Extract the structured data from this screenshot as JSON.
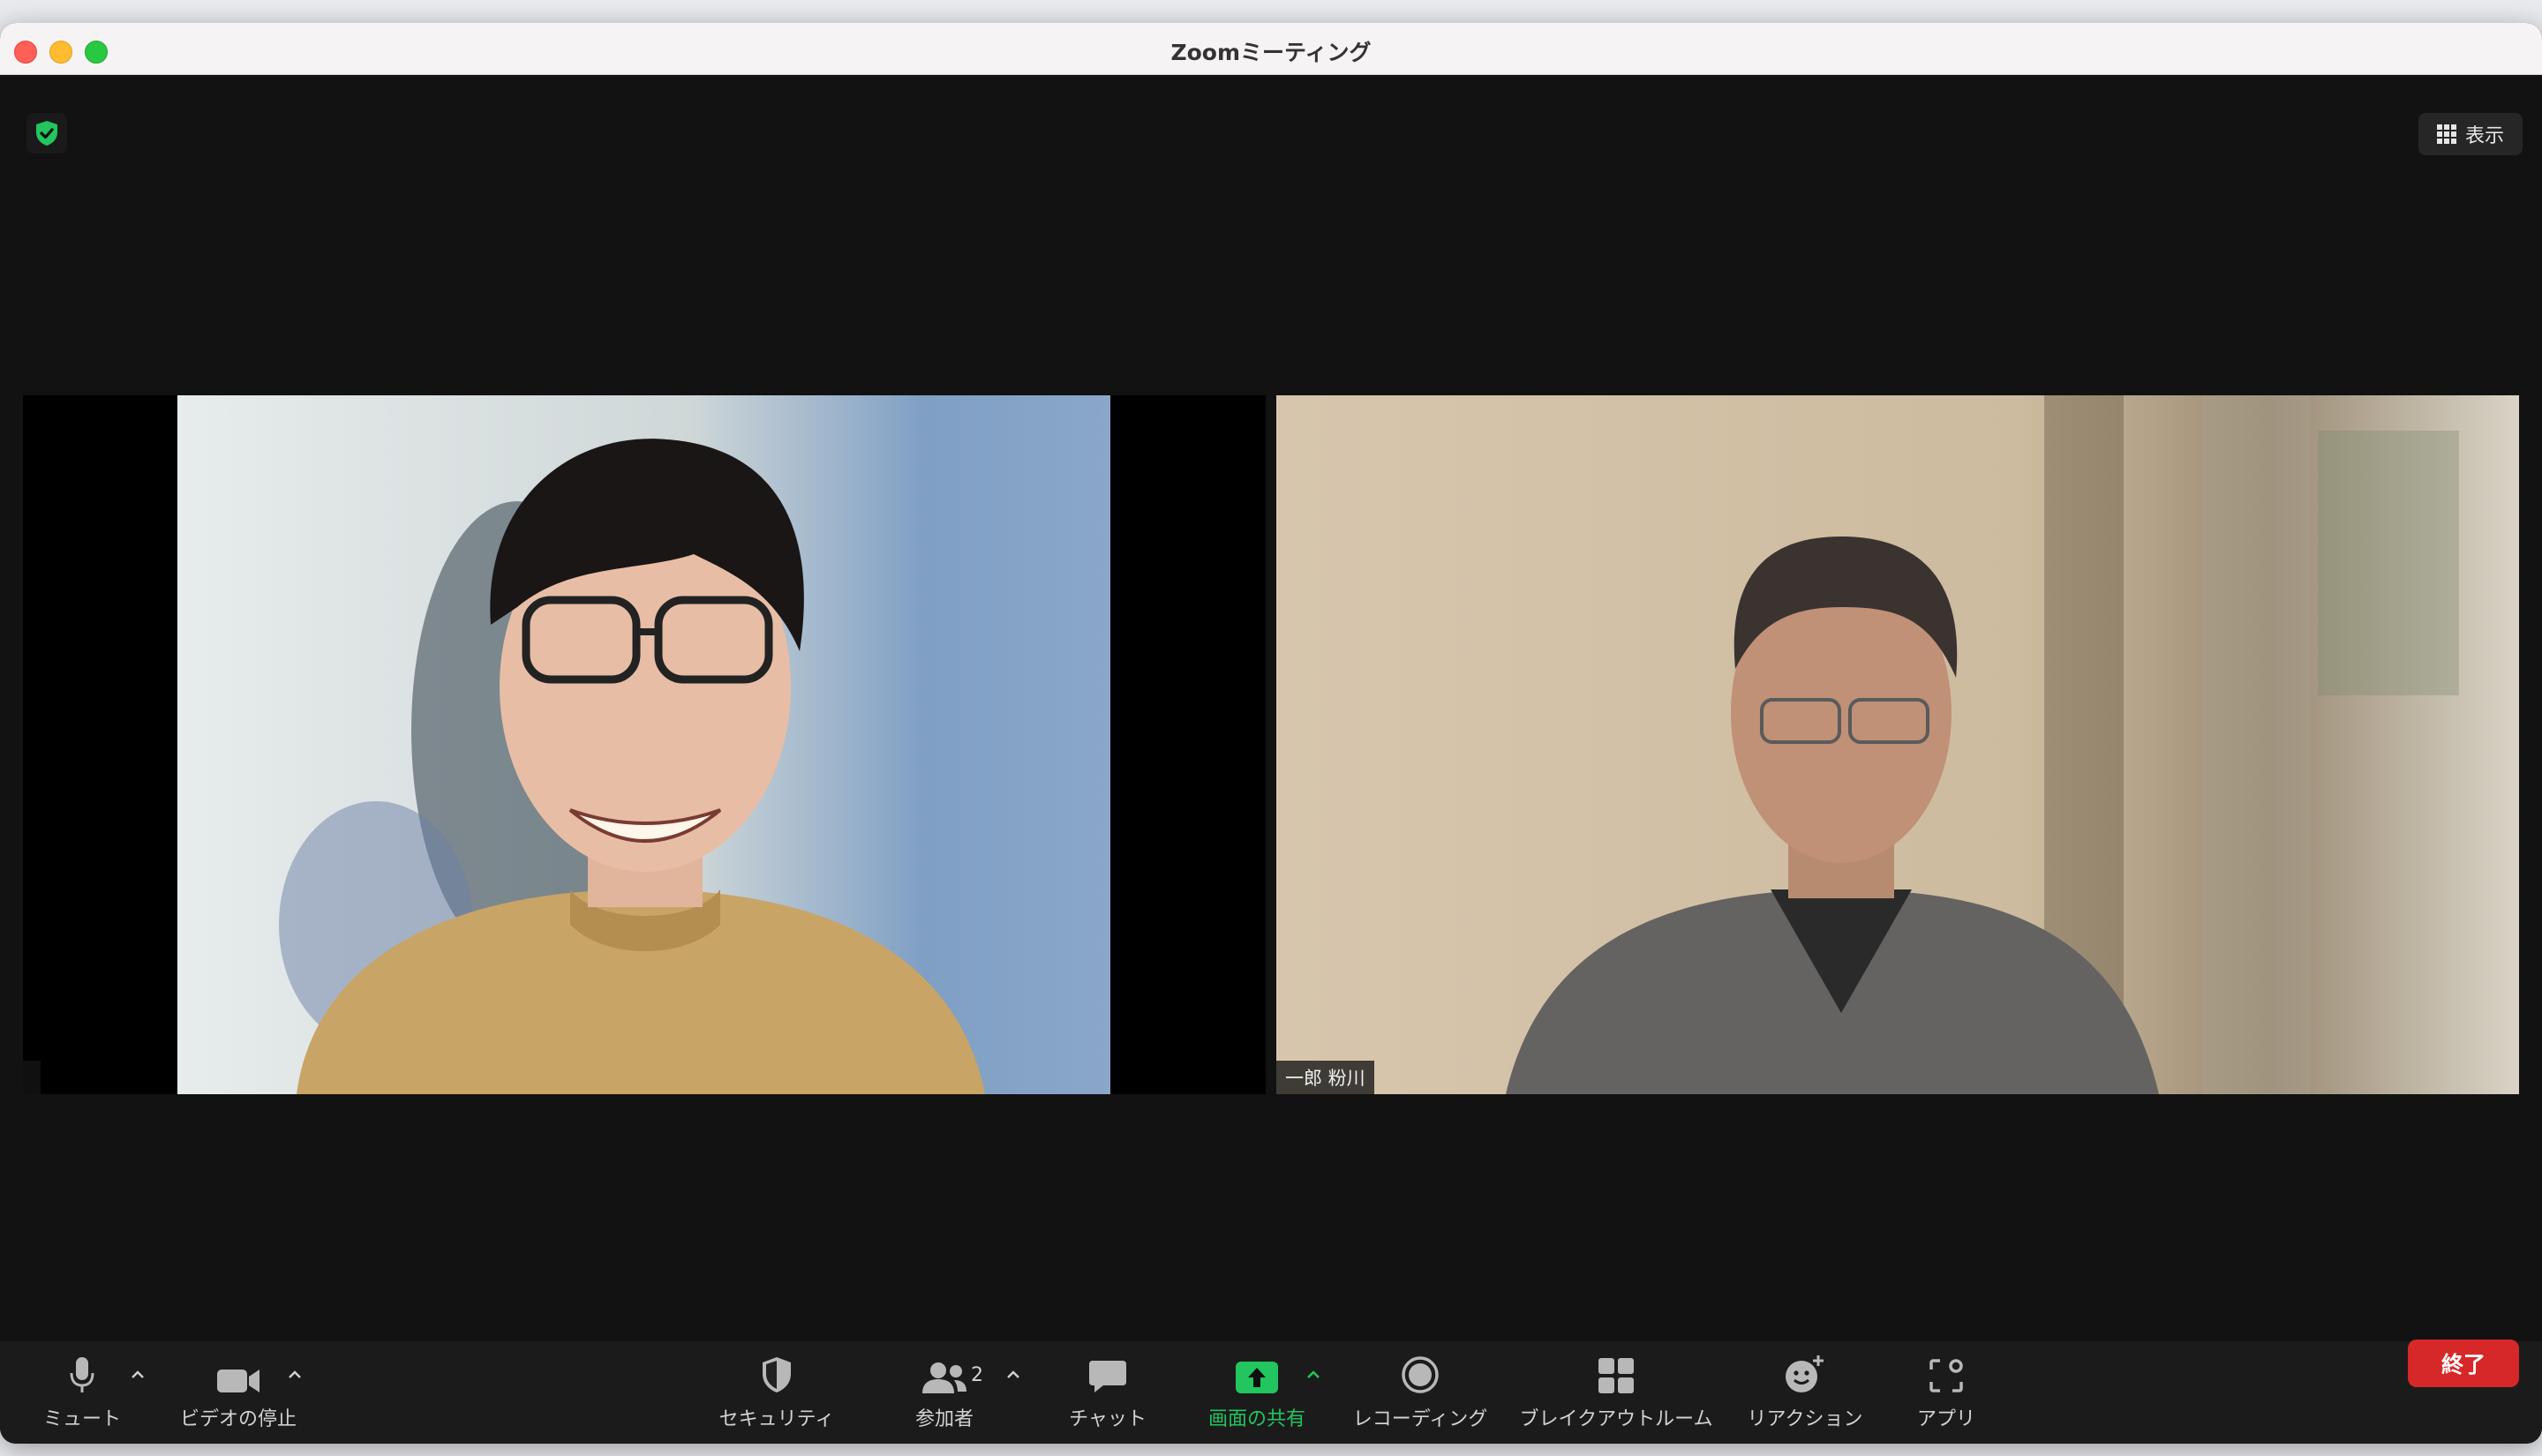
{
  "window": {
    "title": "Zoomミーティング"
  },
  "top_right": {
    "view_label": "表示"
  },
  "participants": [
    {
      "name": ""
    },
    {
      "name": "一郎 粉川"
    }
  ],
  "toolbar": {
    "mute_label": "ミュート",
    "video_label": "ビデオの停止",
    "security_label": "セキュリティ",
    "participants_label": "参加者",
    "participants_count": "2",
    "chat_label": "チャット",
    "share_label": "画面の共有",
    "record_label": "レコーディング",
    "breakout_label": "ブレイクアウトルーム",
    "reactions_label": "リアクション",
    "apps_label": "アプリ",
    "end_label": "終了"
  },
  "colors": {
    "accent_green": "#22c55e",
    "end_red": "#d62828",
    "meeting_bg": "#121212"
  }
}
